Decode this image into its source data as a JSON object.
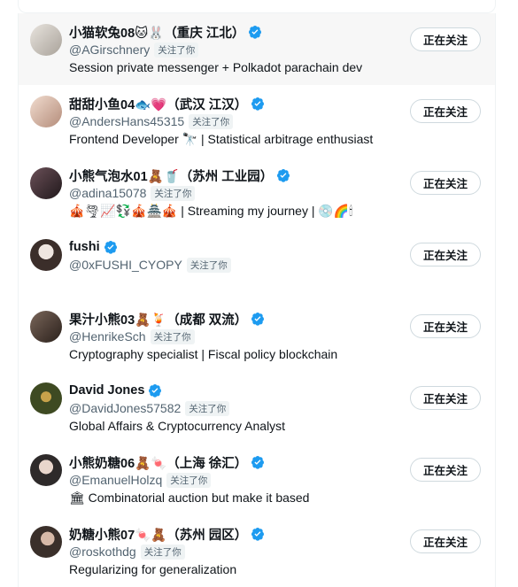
{
  "follow_button_label": "正在关注",
  "follows_you_label": "关注了你",
  "users": [
    {
      "name": "小猫软兔08🐱🐰（重庆 江北）",
      "handle": "@AGirschnery",
      "bio": "Session private messenger + Polkadot parachain dev",
      "avatar_color": "#c9c4bd",
      "hover": true
    },
    {
      "name": "甜甜小鱼04🐟💗（武汉 江汉）",
      "handle": "@AndersHans45315",
      "bio": "Frontend Developer 🔭 | Statistical arbitrage enthusiast",
      "avatar_color": "#d9b8a8",
      "hover": false
    },
    {
      "name": "小熊气泡水01🧸🥤（苏州 工业园）",
      "handle": "@adina15078",
      "bio": "🎪🌪📈💱🎪🏯🎪 | Streaming my journey | 💿🌈🕯",
      "avatar_color": "#3a2a2e",
      "hover": false
    },
    {
      "name": "fushi",
      "handle": "@0xFUSHI_CYOPY",
      "bio": "",
      "avatar_color": "#5a4a44",
      "hover": false
    },
    {
      "name": "果汁小熊03🧸🍹（成都 双流）",
      "handle": "@HenrikeSch",
      "bio": "Cryptography specialist | Fiscal policy blockchain",
      "avatar_color": "#4b3b33",
      "hover": false
    },
    {
      "name": "David Jones",
      "handle": "@DavidJones57582",
      "bio": "Global Affairs & Cryptocurrency Analyst",
      "avatar_color": "#3e4a22",
      "hover": false
    },
    {
      "name": "小熊奶糖06🧸🍬（上海 徐汇）",
      "handle": "@EmanuelHolzq",
      "bio": "🏛 Combinatorial auction but make it based",
      "avatar_color": "#2e2a2a",
      "hover": false
    },
    {
      "name": "奶糖小熊07🍬🧸（苏州 园区）",
      "handle": "@roskothdg",
      "bio": "Regularizing for generalization",
      "avatar_color": "#3a2f2a",
      "hover": false
    }
  ],
  "colors": {
    "verified": "#1d9bf0",
    "secondary_text": "#536471",
    "border": "#cfd9de"
  }
}
